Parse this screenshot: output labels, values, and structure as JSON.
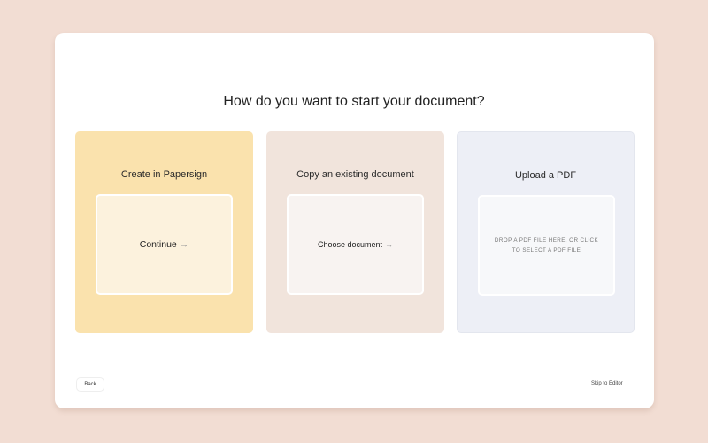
{
  "title": "How do you want to start your document?",
  "cards": [
    {
      "title": "Create in Papersign",
      "action": "Continue",
      "icon": "arrow-right-icon",
      "color": "#fae2ad"
    },
    {
      "title": "Copy an existing document",
      "action": "Choose document",
      "icon": "arrow-right-icon",
      "color": "#f1e4dc"
    },
    {
      "title": "Upload a PDF",
      "action": "DROP A PDF FILE HERE, OR CLICK TO SELECT A PDF FILE",
      "color": "#edeff6"
    }
  ],
  "footer": {
    "back": "Back",
    "skip": "Skip to Editor"
  },
  "arrow": "→"
}
